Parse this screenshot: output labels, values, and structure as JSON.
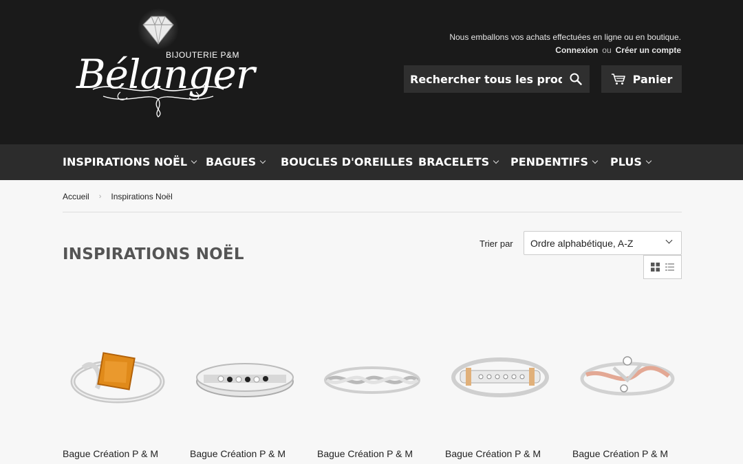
{
  "header": {
    "logo_sub": "BIJOUTERIE P&M",
    "logo_name": "Bélanger",
    "announcement": "Nous emballons vos achats effectuées en ligne ou en boutique.",
    "login_label": "Connexion",
    "or_label": "ou",
    "register_label": "Créer un compte",
    "search_placeholder": "Rechercher tous les produits...",
    "cart_label": "Panier"
  },
  "nav": {
    "items": [
      {
        "label": "INSPIRATIONS NOËL",
        "dropdown": true
      },
      {
        "label": "BAGUES",
        "dropdown": true
      },
      {
        "label": "BOUCLES D'OREILLES",
        "dropdown": false
      },
      {
        "label": "BRACELETS",
        "dropdown": true
      },
      {
        "label": "PENDENTIFS",
        "dropdown": true
      },
      {
        "label": "PLUS",
        "dropdown": true
      }
    ]
  },
  "breadcrumb": [
    "Accueil",
    "Inspirations Noël"
  ],
  "page": {
    "title": "INSPIRATIONS NOËL",
    "sort_label": "Trier par",
    "sort_value": "Ordre alphabétique, A-Z"
  },
  "products": [
    {
      "name": "Bague Création P & M",
      "stone": "orange-square"
    },
    {
      "name": "Bague Création P & M",
      "stone": "black-white-band"
    },
    {
      "name": "Bague Création P & M",
      "stone": "twist-band"
    },
    {
      "name": "Bague Création P & M",
      "stone": "channel-gold"
    },
    {
      "name": "Bague Création P & M",
      "stone": "rose-bypass"
    }
  ],
  "icons": {
    "search": "search-icon",
    "cart": "cart-icon",
    "grid": "grid-view-icon",
    "list": "list-view-icon"
  },
  "colors": {
    "header_bg": "#1a1a1a",
    "nav_bg": "#2c2c2c",
    "page_bg": "#f7f7f7"
  }
}
